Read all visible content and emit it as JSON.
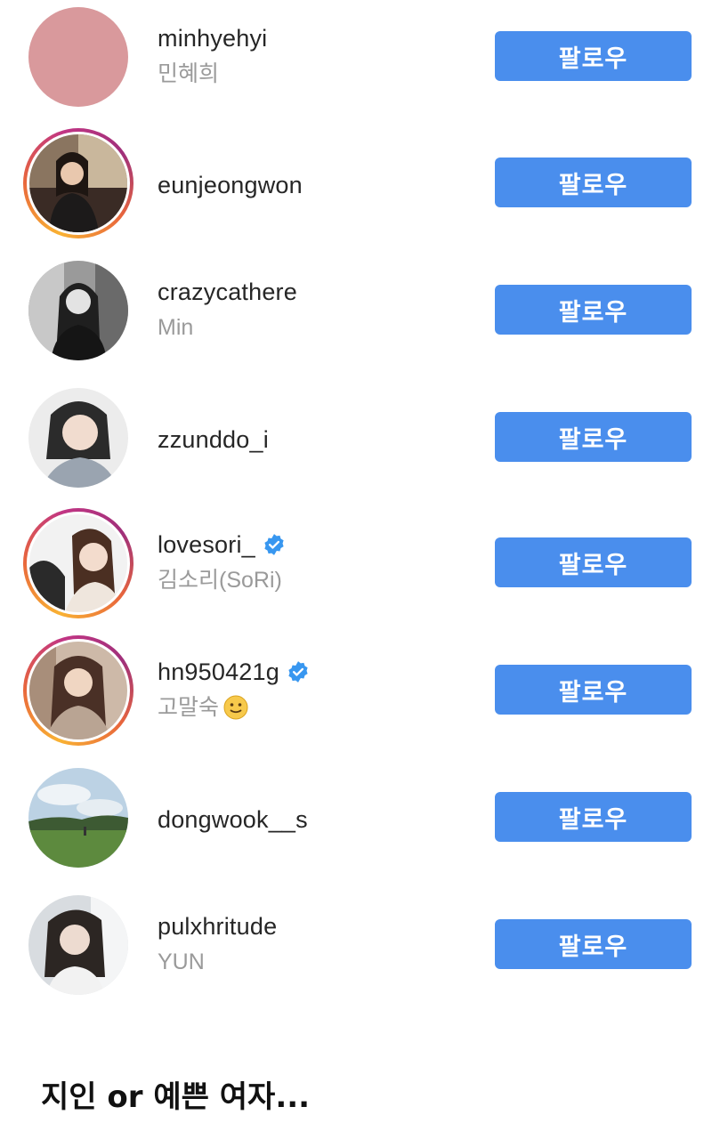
{
  "follow_list": [
    {
      "username": "minhyehyi",
      "fullname": "민혜희",
      "verified": false,
      "story_ring": false,
      "button_label": "팔로우"
    },
    {
      "username": "eunjeongwon",
      "fullname": "",
      "verified": false,
      "story_ring": true,
      "button_label": "팔로우"
    },
    {
      "username": "crazycathere",
      "fullname": "Min",
      "verified": false,
      "story_ring": false,
      "button_label": "팔로우"
    },
    {
      "username": "zzunddo_i",
      "fullname": "",
      "verified": false,
      "story_ring": false,
      "button_label": "팔로우"
    },
    {
      "username": "lovesori_",
      "fullname": "김소리(SoRi)",
      "verified": true,
      "story_ring": true,
      "button_label": "팔로우"
    },
    {
      "username": "hn950421g",
      "fullname": "고말숙",
      "fullname_emoji": "slightly-smiling-face",
      "verified": true,
      "story_ring": true,
      "button_label": "팔로우"
    },
    {
      "username": "dongwook__s",
      "fullname": "",
      "verified": false,
      "story_ring": false,
      "button_label": "팔로우"
    },
    {
      "username": "pulxhritude",
      "fullname": "YUN",
      "verified": false,
      "story_ring": false,
      "button_label": "팔로우"
    }
  ],
  "caption": "지인 or 예쁜 여자...",
  "colors": {
    "follow_button": "#4a8eed",
    "username_text": "#262626",
    "fullname_text": "#9a9a9a",
    "verified_badge": "#3897f0"
  }
}
